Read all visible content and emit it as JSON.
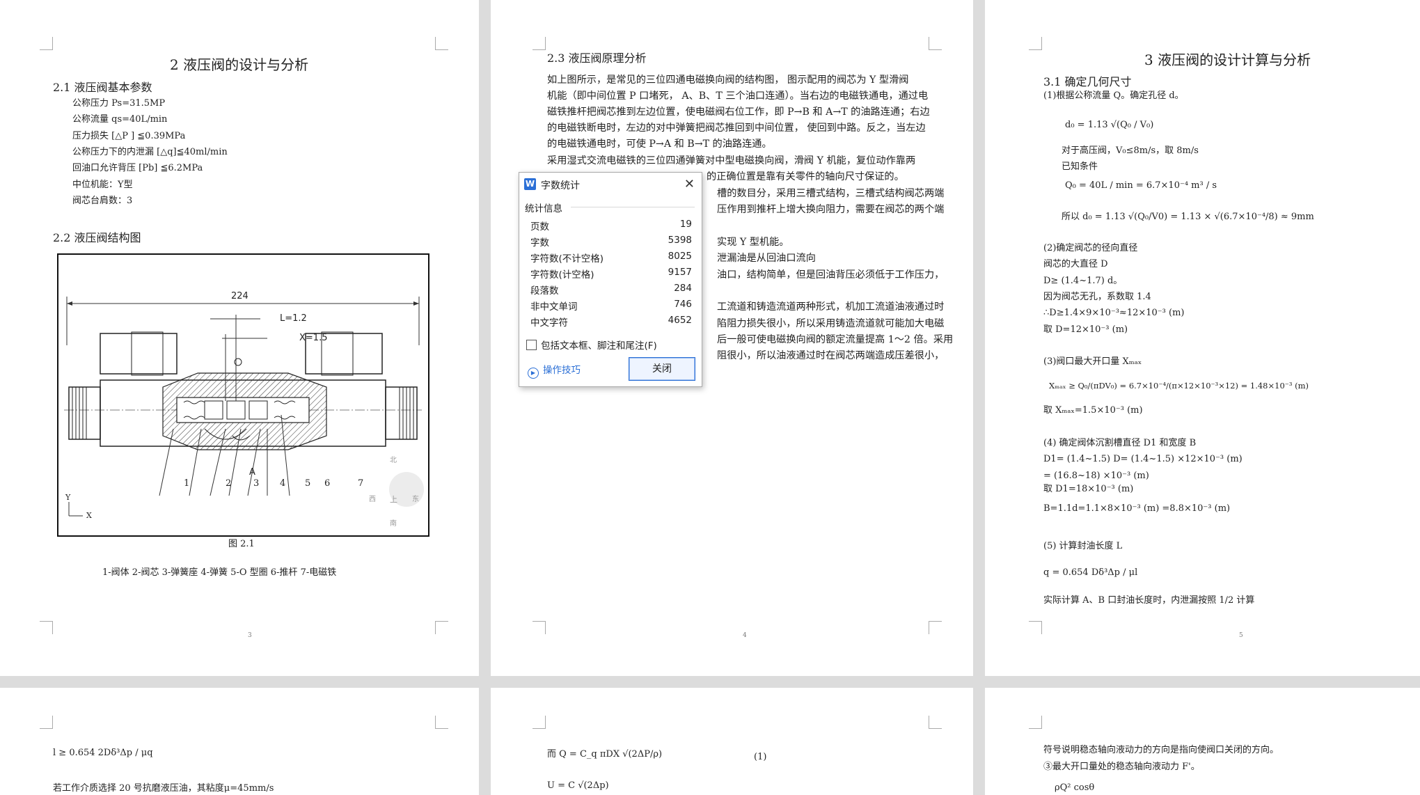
{
  "page3": {
    "title": "2  液压阀的设计与分析",
    "sec21": "2.1  液压阀基本参数",
    "params": [
      "公称压力     Ps=31.5MP",
      "公称流量     qs=40L/min",
      "压力损失  [△P ] ≦0.39MPa",
      "公称压力下的内泄漏     [△q]≦40ml/min",
      "回油口允许背压    [Pb] ≦6.2MPa",
      "中位机能：Y型",
      "阀芯台肩数：3"
    ],
    "sec22": "2.2  液压阀结构图",
    "figure": {
      "dim224": "224",
      "dimL": "L=1.2",
      "dimX": "X=1.5",
      "labels": [
        "1",
        "2",
        "3",
        "4",
        "5",
        "6",
        "7"
      ],
      "labelA": "A",
      "axisY": "Y",
      "axisX": "X",
      "compass": [
        "北",
        "西",
        "上",
        "东",
        "南"
      ]
    },
    "caption": "图 2.1",
    "legend": "1-阀体   2-阀芯   3-弹簧座   4-弹簧    5-O 型圈  6-推杆  7-电磁铁",
    "page_no": "3"
  },
  "page4": {
    "heading": "2.3  液压阀原理分析",
    "lines_top": [
      "    如上图所示，是常见的三位四通电磁换向阀的结构图， 图示配用的阀芯为 Y 型滑阀",
      "机能（即中间位置 P 口堵死，  A、B、T 三个油口连通）。当右边的电磁铁通电，通过电",
      "磁铁推杆把阀芯推到左边位置，使电磁阀右位工作，即 P→B 和 A→T 的油路连通；右边",
      "的电磁铁断电时，左边的对中弹簧把阀芯推回到中间位置，  使回到中路。反之，当左边",
      "的电磁铁通电时，可使 P→A 和 B→T 的油路连通。",
      "    采用湿式交流电磁铁的三位四通弹簧对中型电磁换向阀，滑阀 Y 机能，复位动作靠两"
    ],
    "lines_right": [
      "的正确位置是靠有关零件的轴向尺寸保证的。",
      "槽的数目分，采用三槽式结构，三槽式结构阀芯两端",
      "压作用到推杆上增大换向阻力，需要在阀芯的两个端",
      "",
      "实现 Y 型机能。",
      "泄漏油是从回油口流向",
      "油口，结构简单，但是回油背压必须低于工作压力，",
      "",
      "工流道和铸造流道两种形式，机加工流道油液通过时",
      "陷阻力损失很小，所以采用铸造流道就可能加大电磁",
      "后一般可使电磁换向阀的额定流量提高 1～2 倍。采用",
      "阻很小，所以油液通过时在阀芯两端造成压差很小，"
    ],
    "page_no": "4"
  },
  "page5": {
    "title": "3  液压阀的设计计算与分析",
    "sec31": "3.1  确定几何尺寸",
    "lines": [
      "(1)根据公称流量 Q。确定孔径 d。",
      "d₀ = 1.13 √(Q₀ / V₀)",
      "对于高压阀，V₀≤8m/s，取 8m/s",
      "已知条件",
      "Q₀ = 40L / min = 6.7×10⁻⁴ m³ / s",
      "所以 d₀ = 1.13 √(Q₀/V0) = 1.13 × √(6.7×10⁻⁴/8) ≈ 9mm",
      "(2)确定阀芯的径向直径",
      " 阀芯的大直径 D",
      "  D≥ (1.4~1.7) d。",
      "  因为阀芯无孔，系数取 1.4",
      "  ∴D≥1.4×9×10⁻³≈12×10⁻³  (m)",
      "  取 D=12×10⁻³  (m)",
      "(3)阀口最大开口量 Xₘₐₓ",
      "Xₘₐₓ ≥ Q₀/(πDV₀) = 6.7×10⁻⁴/(π×12×10⁻³×12) = 1.48×10⁻³ (m)",
      "  取 Xₘₐₓ=1.5×10⁻³  (m)",
      " (4) 确定阀体沉割槽直径 D1 和宽度 B",
      "  D1=  (1.4~1.5) D=  (1.4~1.5) ×12×10⁻³  (m)",
      "  =  (16.8~18)  ×10⁻³  (m)",
      "取 D1=18×10⁻³  (m)",
      "B=1.1d=1.1×8×10⁻³  (m)  =8.8×10⁻³  (m)",
      " (5) 计算封油长度 L",
      "q = 0.654 Dδ³Δp / μl",
      "实际计算 A、B 口封油长度时，内泄漏按照 1/2 计算"
    ],
    "page_no": "5"
  },
  "page6": {
    "formula": "l ≥ 0.654 2Dδ³Δp / μq",
    "line": "若工作介质选择 20 号抗磨液压油，其粘度μ=45mm/s"
  },
  "page7": {
    "formula1": "而 Q = C_q πDX √(2ΔP/ρ)",
    "eqno": "(1)",
    "formula2": "U = C √(2Δp)"
  },
  "page8": {
    "line1": "符号说明稳态轴向液动力的方向是指向使阀口关闭的方向。",
    "line2": "③最大开口量处的稳态轴向液动力 F'。",
    "formula": "ρQ² cosθ"
  },
  "dialog": {
    "title": "字数统计",
    "section": "统计信息",
    "rows": [
      {
        "k": "页数",
        "v": "19"
      },
      {
        "k": "字数",
        "v": "5398"
      },
      {
        "k": "字符数(不计空格)",
        "v": "8025"
      },
      {
        "k": "字符数(计空格)",
        "v": "9157"
      },
      {
        "k": "段落数",
        "v": "284"
      },
      {
        "k": "非中文单词",
        "v": "746"
      },
      {
        "k": "中文字符",
        "v": "4652"
      }
    ],
    "checkbox": "包括文本框、脚注和尾注(F)",
    "tips": "操作技巧",
    "close": "关闭",
    "logo": "W"
  }
}
